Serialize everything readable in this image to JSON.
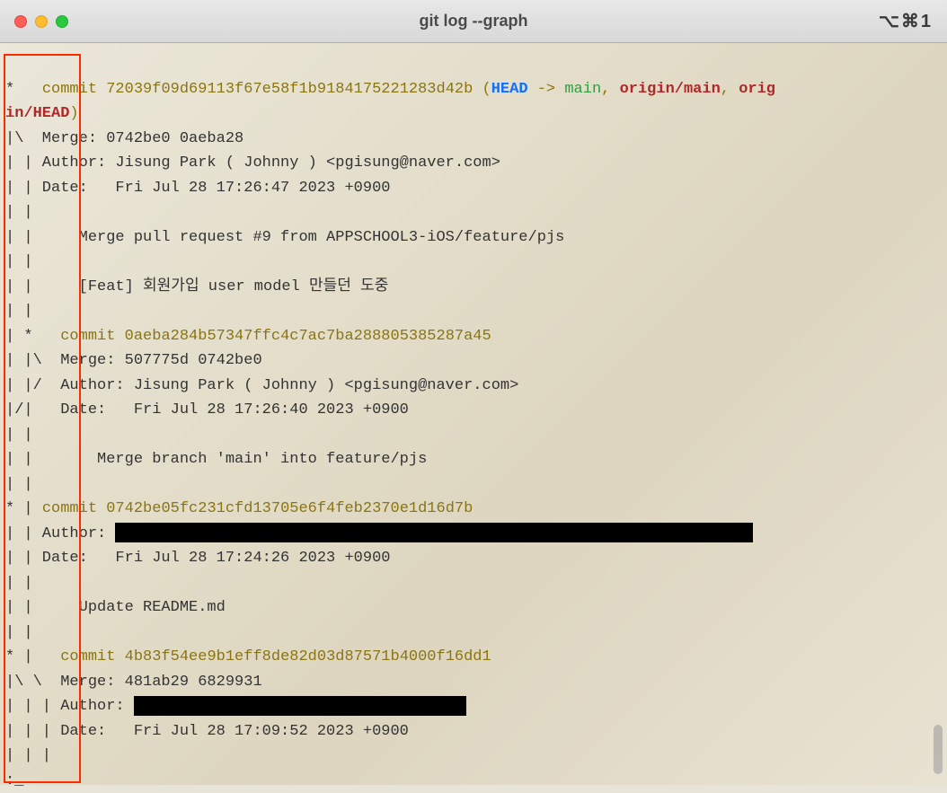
{
  "window": {
    "title": "git log --graph",
    "shortcut": "⌥⌘1"
  },
  "log": {
    "c1": {
      "graph": "*   ",
      "commit_label": "commit ",
      "hash": "72039f09d69113f67e58f1b9184175221283d42b",
      "refs_open": " (",
      "head": "HEAD",
      "arrow": " -> ",
      "main": "main",
      "sep1": ", ",
      "origin_main": "origin/main",
      "sep2": ", ",
      "origin_head_a": "orig",
      "origin_head_b": "in/HEAD",
      "refs_close": ")",
      "merge_line": "|\\  Merge: 0742be0 0aeba28",
      "author_line": "| | Author: Jisung Park ( Johnny ) <pgisung@naver.com>",
      "date_line": "| | Date:   Fri Jul 28 17:26:47 2023 +0900",
      "blank1": "| | ",
      "msg1": "| |     Merge pull request #9 from APPSCHOOL3-iOS/feature/pjs",
      "blank2": "| | ",
      "msg2": "| |     [Feat] 회원가입 user model 만들던 도중",
      "blank3": "| | "
    },
    "c2": {
      "graph": "| *   ",
      "commit_label": "commit ",
      "hash": "0aeba284b57347ffc4c7ac7ba288805385287a45",
      "merge_line": "| |\\  Merge: 507775d 0742be0",
      "author_line": "| |/  Author: Jisung Park ( Johnny ) <pgisung@naver.com>",
      "date_line": "|/|   Date:   Fri Jul 28 17:26:40 2023 +0900",
      "blank1": "| | ",
      "msg1": "| |       Merge branch 'main' into feature/pjs",
      "blank2": "| | "
    },
    "c3": {
      "graph": "* | ",
      "commit_label": "commit ",
      "hash": "0742be05fc231cfd13705e6f4feb2370e1d16d7b",
      "author_prefix": "| | Author: ",
      "date_line": "| | Date:   Fri Jul 28 17:24:26 2023 +0900",
      "blank1": "| | ",
      "msg1": "| |     Update README.md",
      "blank2": "| | "
    },
    "c4": {
      "graph": "* |   ",
      "commit_label": "commit ",
      "hash": "4b83f54ee9b1eff8de82d03d87571b4000f16dd1",
      "merge_line": "|\\ \\  Merge: 481ab29 6829931",
      "author_prefix": "| | | Author: ",
      "date_line": "| | | Date:   Fri Jul 28 17:09:52 2023 +0900",
      "blank1": "| | | "
    },
    "prompt": ":"
  }
}
